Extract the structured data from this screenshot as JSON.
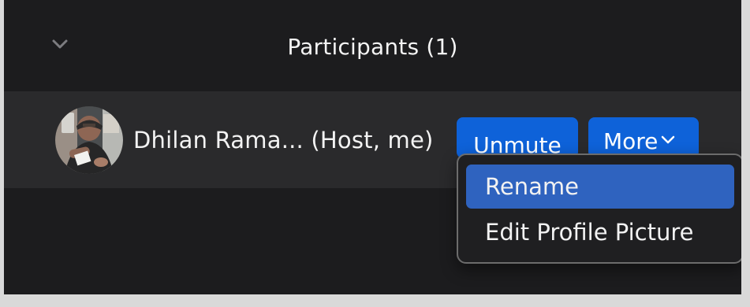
{
  "panel": {
    "title": "Participants (1)",
    "collapse_icon": "chevron-down-icon"
  },
  "participant": {
    "name": "Dhilan Rama...  (Host, me)",
    "avatar_icon": "user-photo-avatar"
  },
  "actions": {
    "unmute_label": "Unmute",
    "more_label": "More",
    "more_icon": "chevron-down-icon"
  },
  "menu": {
    "items": [
      {
        "label": "Rename",
        "selected": true
      },
      {
        "label": "Edit Profile Picture",
        "selected": false
      }
    ]
  },
  "colors": {
    "panel_background": "#1c1c1e",
    "row_background": "#2a2a2c",
    "button_blue": "#0e62d9",
    "menu_highlight": "#2f63bf",
    "text": "#f3f3f3"
  }
}
